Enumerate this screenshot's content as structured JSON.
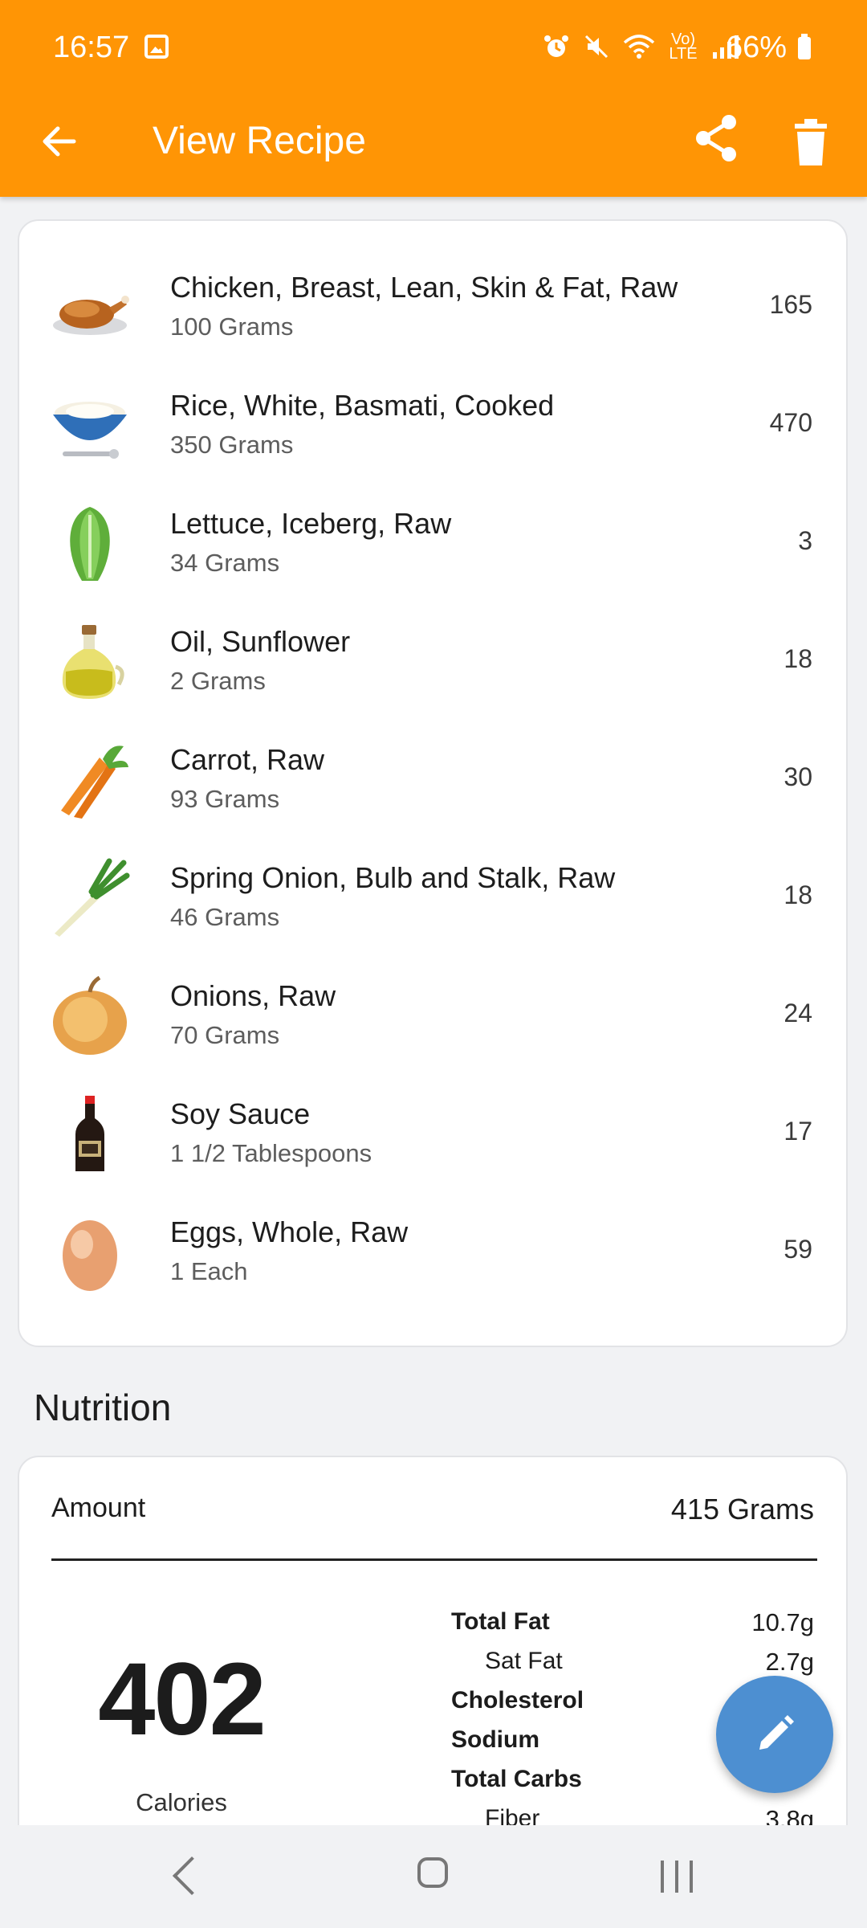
{
  "status_bar": {
    "time": "16:57",
    "battery": "66%",
    "network": "LTE"
  },
  "app_bar": {
    "title": "View Recipe"
  },
  "ingredients": [
    {
      "name": "Chicken, Breast, Lean, Skin & Fat, Raw",
      "quantity": "100 Grams",
      "calories": "165",
      "icon": "roast-chicken-icon"
    },
    {
      "name": "Rice, White, Basmati, Cooked",
      "quantity": "350 Grams",
      "calories": "470",
      "icon": "rice-bowl-icon"
    },
    {
      "name": "Lettuce, Iceberg, Raw",
      "quantity": "34 Grams",
      "calories": "3",
      "icon": "lettuce-icon"
    },
    {
      "name": "Oil, Sunflower",
      "quantity": "2 Grams",
      "calories": "18",
      "icon": "oil-bottle-icon"
    },
    {
      "name": "Carrot, Raw",
      "quantity": "93 Grams",
      "calories": "30",
      "icon": "carrot-icon"
    },
    {
      "name": "Spring Onion, Bulb and Stalk, Raw",
      "quantity": "46 Grams",
      "calories": "18",
      "icon": "spring-onion-icon"
    },
    {
      "name": "Onions, Raw",
      "quantity": "70 Grams",
      "calories": "24",
      "icon": "onion-icon"
    },
    {
      "name": "Soy Sauce",
      "quantity": "1 1/2 Tablespoons",
      "calories": "17",
      "icon": "soy-sauce-bottle-icon"
    },
    {
      "name": "Eggs, Whole, Raw",
      "quantity": "1 Each",
      "calories": "59",
      "icon": "egg-icon"
    }
  ],
  "nutrition": {
    "section_title": "Nutrition",
    "amount_label": "Amount",
    "amount_value": "415 Grams",
    "calories_value": "402",
    "calories_label": "Calories",
    "rows": [
      {
        "name": "Total Fat",
        "value": "10.7g",
        "bold": true
      },
      {
        "name": "Sat Fat",
        "value": "2.7g",
        "bold": false
      },
      {
        "name": "Cholesterol",
        "value": "",
        "bold": true
      },
      {
        "name": "Sodium",
        "value": "",
        "bold": true
      },
      {
        "name": "Total Carbs",
        "value": "",
        "bold": true
      },
      {
        "name": "Fiber",
        "value": "3.8g",
        "bold": false
      }
    ]
  },
  "colors": {
    "accent": "#ff9505",
    "fab": "#4d8fd1"
  }
}
